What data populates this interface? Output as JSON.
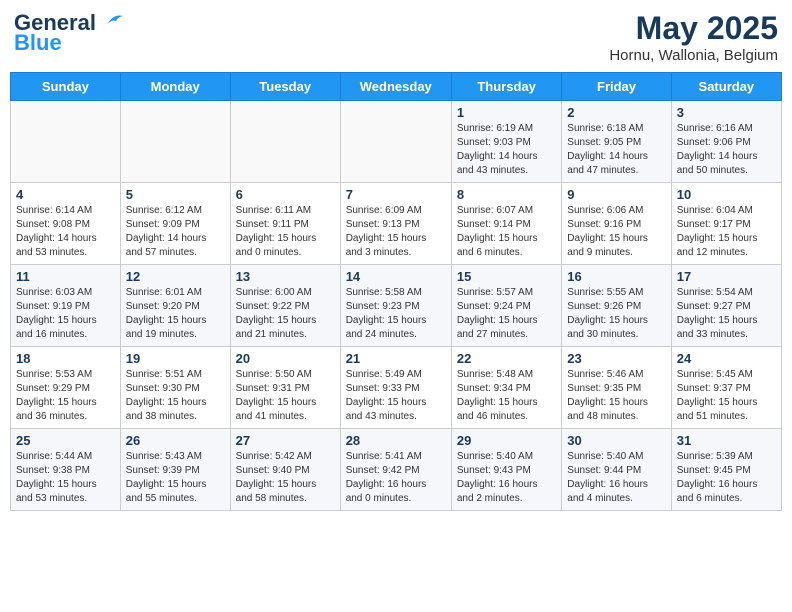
{
  "header": {
    "logo_general": "General",
    "logo_blue": "Blue",
    "month_year": "May 2025",
    "location": "Hornu, Wallonia, Belgium"
  },
  "weekdays": [
    "Sunday",
    "Monday",
    "Tuesday",
    "Wednesday",
    "Thursday",
    "Friday",
    "Saturday"
  ],
  "weeks": [
    [
      {
        "day": "",
        "info": ""
      },
      {
        "day": "",
        "info": ""
      },
      {
        "day": "",
        "info": ""
      },
      {
        "day": "",
        "info": ""
      },
      {
        "day": "1",
        "info": "Sunrise: 6:19 AM\nSunset: 9:03 PM\nDaylight: 14 hours\nand 43 minutes."
      },
      {
        "day": "2",
        "info": "Sunrise: 6:18 AM\nSunset: 9:05 PM\nDaylight: 14 hours\nand 47 minutes."
      },
      {
        "day": "3",
        "info": "Sunrise: 6:16 AM\nSunset: 9:06 PM\nDaylight: 14 hours\nand 50 minutes."
      }
    ],
    [
      {
        "day": "4",
        "info": "Sunrise: 6:14 AM\nSunset: 9:08 PM\nDaylight: 14 hours\nand 53 minutes."
      },
      {
        "day": "5",
        "info": "Sunrise: 6:12 AM\nSunset: 9:09 PM\nDaylight: 14 hours\nand 57 minutes."
      },
      {
        "day": "6",
        "info": "Sunrise: 6:11 AM\nSunset: 9:11 PM\nDaylight: 15 hours\nand 0 minutes."
      },
      {
        "day": "7",
        "info": "Sunrise: 6:09 AM\nSunset: 9:13 PM\nDaylight: 15 hours\nand 3 minutes."
      },
      {
        "day": "8",
        "info": "Sunrise: 6:07 AM\nSunset: 9:14 PM\nDaylight: 15 hours\nand 6 minutes."
      },
      {
        "day": "9",
        "info": "Sunrise: 6:06 AM\nSunset: 9:16 PM\nDaylight: 15 hours\nand 9 minutes."
      },
      {
        "day": "10",
        "info": "Sunrise: 6:04 AM\nSunset: 9:17 PM\nDaylight: 15 hours\nand 12 minutes."
      }
    ],
    [
      {
        "day": "11",
        "info": "Sunrise: 6:03 AM\nSunset: 9:19 PM\nDaylight: 15 hours\nand 16 minutes."
      },
      {
        "day": "12",
        "info": "Sunrise: 6:01 AM\nSunset: 9:20 PM\nDaylight: 15 hours\nand 19 minutes."
      },
      {
        "day": "13",
        "info": "Sunrise: 6:00 AM\nSunset: 9:22 PM\nDaylight: 15 hours\nand 21 minutes."
      },
      {
        "day": "14",
        "info": "Sunrise: 5:58 AM\nSunset: 9:23 PM\nDaylight: 15 hours\nand 24 minutes."
      },
      {
        "day": "15",
        "info": "Sunrise: 5:57 AM\nSunset: 9:24 PM\nDaylight: 15 hours\nand 27 minutes."
      },
      {
        "day": "16",
        "info": "Sunrise: 5:55 AM\nSunset: 9:26 PM\nDaylight: 15 hours\nand 30 minutes."
      },
      {
        "day": "17",
        "info": "Sunrise: 5:54 AM\nSunset: 9:27 PM\nDaylight: 15 hours\nand 33 minutes."
      }
    ],
    [
      {
        "day": "18",
        "info": "Sunrise: 5:53 AM\nSunset: 9:29 PM\nDaylight: 15 hours\nand 36 minutes."
      },
      {
        "day": "19",
        "info": "Sunrise: 5:51 AM\nSunset: 9:30 PM\nDaylight: 15 hours\nand 38 minutes."
      },
      {
        "day": "20",
        "info": "Sunrise: 5:50 AM\nSunset: 9:31 PM\nDaylight: 15 hours\nand 41 minutes."
      },
      {
        "day": "21",
        "info": "Sunrise: 5:49 AM\nSunset: 9:33 PM\nDaylight: 15 hours\nand 43 minutes."
      },
      {
        "day": "22",
        "info": "Sunrise: 5:48 AM\nSunset: 9:34 PM\nDaylight: 15 hours\nand 46 minutes."
      },
      {
        "day": "23",
        "info": "Sunrise: 5:46 AM\nSunset: 9:35 PM\nDaylight: 15 hours\nand 48 minutes."
      },
      {
        "day": "24",
        "info": "Sunrise: 5:45 AM\nSunset: 9:37 PM\nDaylight: 15 hours\nand 51 minutes."
      }
    ],
    [
      {
        "day": "25",
        "info": "Sunrise: 5:44 AM\nSunset: 9:38 PM\nDaylight: 15 hours\nand 53 minutes."
      },
      {
        "day": "26",
        "info": "Sunrise: 5:43 AM\nSunset: 9:39 PM\nDaylight: 15 hours\nand 55 minutes."
      },
      {
        "day": "27",
        "info": "Sunrise: 5:42 AM\nSunset: 9:40 PM\nDaylight: 15 hours\nand 58 minutes."
      },
      {
        "day": "28",
        "info": "Sunrise: 5:41 AM\nSunset: 9:42 PM\nDaylight: 16 hours\nand 0 minutes."
      },
      {
        "day": "29",
        "info": "Sunrise: 5:40 AM\nSunset: 9:43 PM\nDaylight: 16 hours\nand 2 minutes."
      },
      {
        "day": "30",
        "info": "Sunrise: 5:40 AM\nSunset: 9:44 PM\nDaylight: 16 hours\nand 4 minutes."
      },
      {
        "day": "31",
        "info": "Sunrise: 5:39 AM\nSunset: 9:45 PM\nDaylight: 16 hours\nand 6 minutes."
      }
    ]
  ]
}
